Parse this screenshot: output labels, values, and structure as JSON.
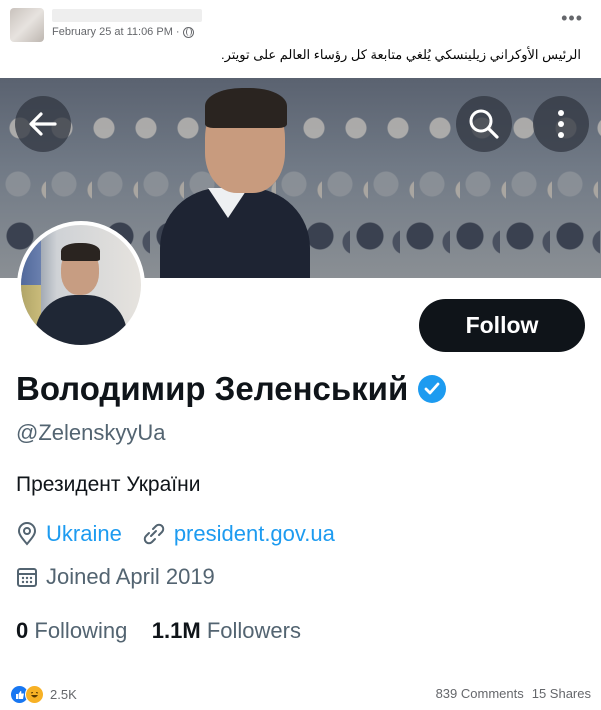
{
  "post": {
    "timestamp": "February 25 at 11:06 PM · ",
    "caption": "الرئيس الأوكراني زيلينسكي يُلغي متابعة كل رؤساء العالم على تويتر."
  },
  "profile": {
    "follow_label": "Follow",
    "display_name": "Володимир Зеленський",
    "handle": "@ZelenskyyUa",
    "bio": "Президент України",
    "location": "Ukraine",
    "website": "president.gov.ua",
    "joined": "Joined April 2019",
    "following_count": "0",
    "following_label": "Following",
    "followers_count": "1.1M",
    "followers_label": "Followers"
  },
  "footer": {
    "reaction_count": "2.5K",
    "comments": "839 Comments",
    "shares": "15 Shares"
  },
  "colors": {
    "twitter_blue": "#1d9bf0",
    "follow_button": "#0f1419",
    "facebook_like": "#1877f2"
  },
  "icons": [
    "globe-icon",
    "more-options-icon",
    "back-arrow-icon",
    "search-icon",
    "more-vertical-icon",
    "verified-badge-icon",
    "location-pin-icon",
    "link-icon",
    "calendar-icon",
    "like-reaction-icon",
    "haha-reaction-icon"
  ]
}
